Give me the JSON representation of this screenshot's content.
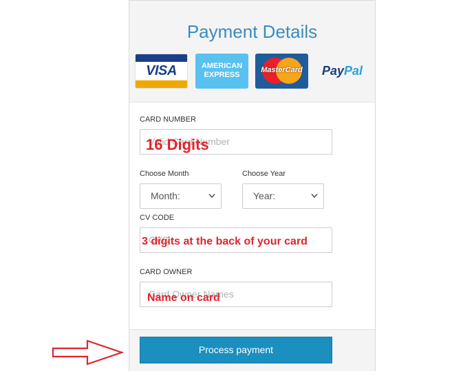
{
  "form": {
    "title": "Payment Details",
    "cards": {
      "visa": "VISA",
      "amex_line1": "AMERICAN",
      "amex_line2": "EXPRESS",
      "mastercard": "MasterCard",
      "paypal_a": "Pay",
      "paypal_b": "Pal"
    },
    "card_number": {
      "label": "CARD NUMBER",
      "placeholder": "Valid Card Number",
      "annotation": "16 Digits"
    },
    "month": {
      "label": "Choose Month",
      "selected": "Month:"
    },
    "year": {
      "label": "Choose Year",
      "selected": "Year:"
    },
    "cv_code": {
      "label": "CV CODE",
      "placeholder": "CVC",
      "annotation": "3 digits at the back of your card"
    },
    "owner": {
      "label": "CARD OWNER",
      "placeholder": "Card Owner Names",
      "annotation": "Name on card"
    },
    "submit": "Process payment"
  },
  "colors": {
    "title": "#3a8bbf",
    "button": "#1b8fbf",
    "annotation": "#e0242c"
  },
  "icons": [
    "visa-logo",
    "amex-logo",
    "mastercard-logo",
    "paypal-logo",
    "chevron-down-icon",
    "arrow-right-icon"
  ]
}
